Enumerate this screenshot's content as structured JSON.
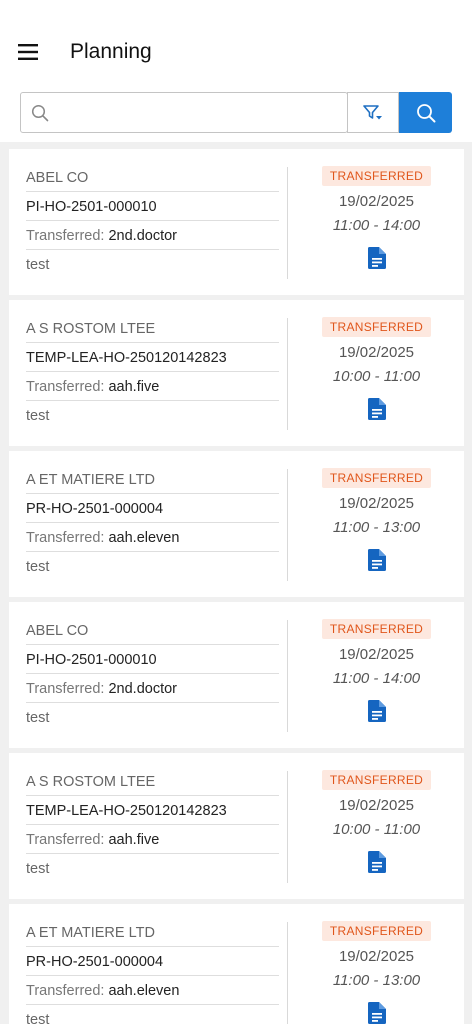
{
  "header": {
    "title": "Planning",
    "menu_icon": "hamburger-menu-icon"
  },
  "search": {
    "value": "",
    "placeholder": "",
    "search_icon": "search-icon",
    "filter_icon": "filter-icon",
    "colors": {
      "accent": "#1e7fd9",
      "badge_bg": "#fde8df",
      "badge_text": "#e0561b",
      "doc_icon": "#1565c0"
    }
  },
  "cards": [
    {
      "customer": "ABEL CO",
      "reference": "PI-HO-2501-000010",
      "transfer_label": "Transferred:",
      "transfer_value": "2nd.doctor",
      "note": "test",
      "status": "TRANSFERRED",
      "date": "19/02/2025",
      "time": "11:00 - 14:00"
    },
    {
      "customer": "A S ROSTOM LTEE",
      "reference": "TEMP-LEA-HO-250120142823",
      "transfer_label": "Transferred:",
      "transfer_value": "aah.five",
      "note": "test",
      "status": "TRANSFERRED",
      "date": "19/02/2025",
      "time": "10:00 - 11:00"
    },
    {
      "customer": "A ET MATIERE LTD",
      "reference": "PR-HO-2501-000004",
      "transfer_label": "Transferred:",
      "transfer_value": "aah.eleven",
      "note": "test",
      "status": "TRANSFERRED",
      "date": "19/02/2025",
      "time": "11:00 - 13:00"
    },
    {
      "customer": "ABEL CO",
      "reference": "PI-HO-2501-000010",
      "transfer_label": "Transferred:",
      "transfer_value": "2nd.doctor",
      "note": "test",
      "status": "TRANSFERRED",
      "date": "19/02/2025",
      "time": "11:00 - 14:00"
    },
    {
      "customer": "A S ROSTOM LTEE",
      "reference": "TEMP-LEA-HO-250120142823",
      "transfer_label": "Transferred:",
      "transfer_value": "aah.five",
      "note": "test",
      "status": "TRANSFERRED",
      "date": "19/02/2025",
      "time": "10:00 - 11:00"
    },
    {
      "customer": "A ET MATIERE LTD",
      "reference": "PR-HO-2501-000004",
      "transfer_label": "Transferred:",
      "transfer_value": "aah.eleven",
      "note": "test",
      "status": "TRANSFERRED",
      "date": "19/02/2025",
      "time": "11:00 - 13:00"
    }
  ]
}
